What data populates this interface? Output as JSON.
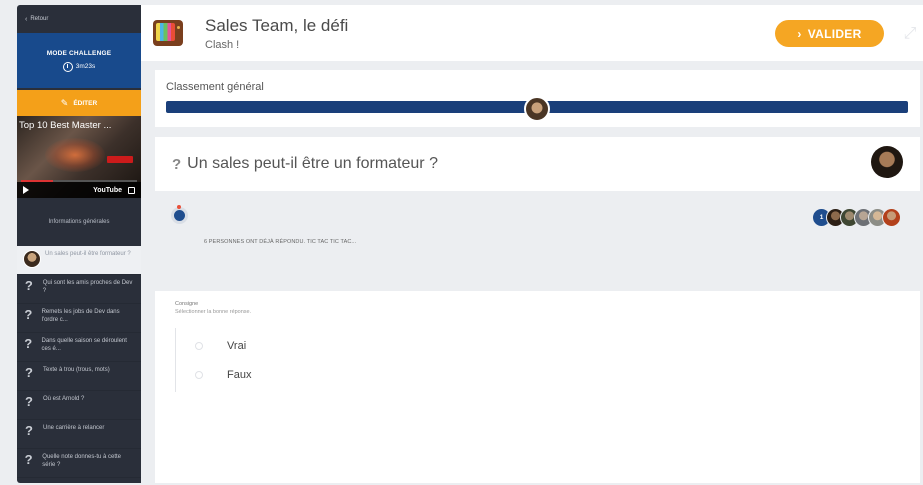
{
  "sidebar": {
    "back_label": "Retour",
    "mode_label": "MODE CHALLENGE",
    "timer": "3m23s",
    "edit_label": "ÉDITER",
    "video": {
      "title": "Top 10 Best Master ...",
      "platform": "YouTube"
    },
    "info_label": "Informations générales",
    "items": [
      {
        "label": "Un sales peut-il être formateur ?",
        "active": true
      },
      {
        "label": "Qui sont les amis proches de Dev ?"
      },
      {
        "label": "Remets les jobs de Dev dans l'ordre c..."
      },
      {
        "label": "Dans quelle saison se déroulent ces é..."
      },
      {
        "label": "Texte à trou (trous, mots)"
      },
      {
        "label": "Où est Arnold ?"
      },
      {
        "label": "Une carrière à relancer"
      },
      {
        "label": "Quelle note donnes-tu à cette série ?"
      }
    ]
  },
  "header": {
    "title": "Sales Team, le défi",
    "subtitle": "Clash !",
    "validate_label": "VALIDER"
  },
  "ranking": {
    "label": "Classement général",
    "progress_fraction": 0.5
  },
  "question": {
    "text": "Un sales peut-il être un formateur ?",
    "answered_text": "6 PERSONNES ONT DÉJÀ RÉPONDU. TIC TAC TIC TAC...",
    "answer_count_badge": "1",
    "consigne_title": "Consigne",
    "consigne_text": "Sélectionner la bonne réponse.",
    "options": [
      "Vrai",
      "Faux"
    ]
  },
  "colors": {
    "accent": "#f5a623",
    "primary": "#1a3f7a",
    "sidebar_bg": "#2a2f3a"
  }
}
